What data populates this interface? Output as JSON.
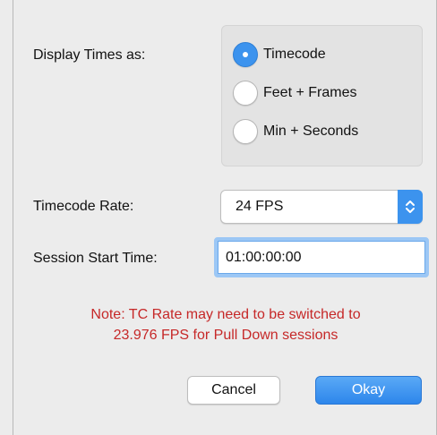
{
  "display_times": {
    "label": "Display Times as:",
    "options": [
      {
        "label": "Timecode",
        "selected": true
      },
      {
        "label": "Feet + Frames",
        "selected": false
      },
      {
        "label": "Min + Seconds",
        "selected": false
      }
    ]
  },
  "timecode_rate": {
    "label": "Timecode Rate:",
    "value": "24 FPS"
  },
  "session_start": {
    "label": "Session Start Time:",
    "value": "01:00:00:00"
  },
  "note": {
    "line1": "Note: TC Rate may need to be switched to",
    "line2": "23.976 FPS for Pull Down sessions"
  },
  "buttons": {
    "cancel": "Cancel",
    "okay": "Okay"
  },
  "colors": {
    "accent": "#3c93ee",
    "note_text": "#c62828"
  }
}
